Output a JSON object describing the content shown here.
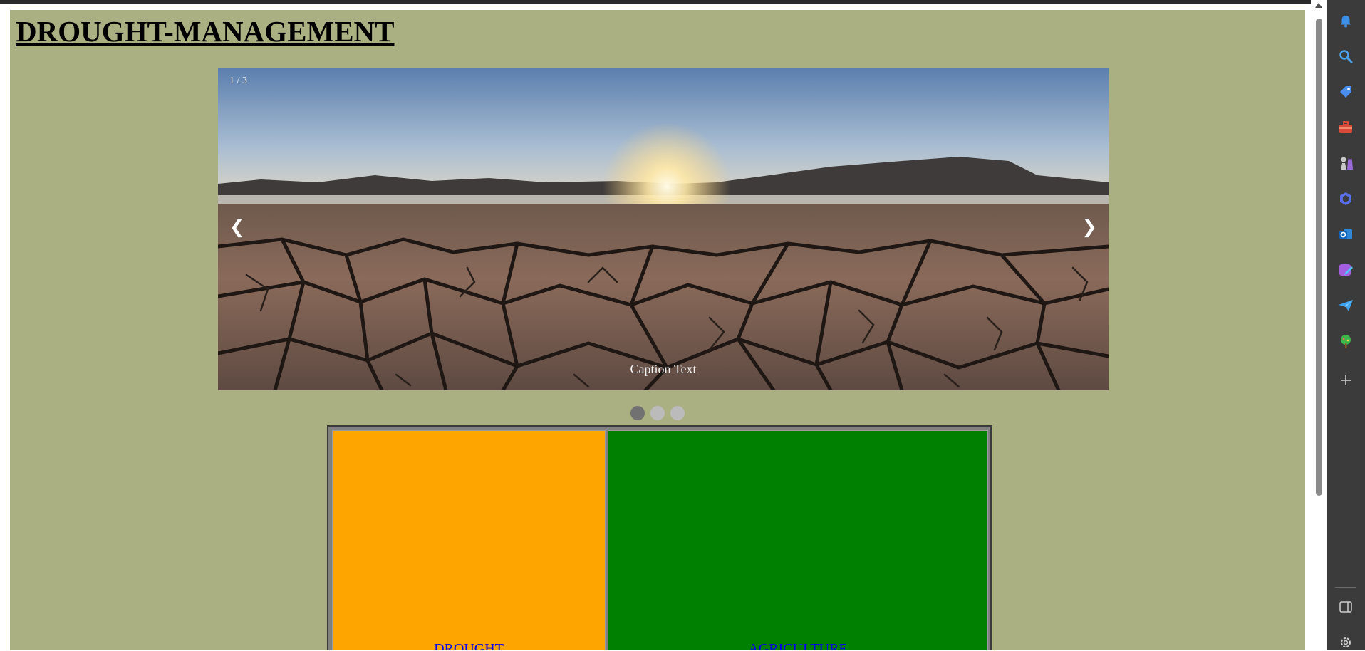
{
  "page": {
    "title": "DROUGHT-MANAGEMENT"
  },
  "slideshow": {
    "number_text": "1 / 3",
    "caption": "Caption Text",
    "prev_label": "❮",
    "next_label": "❯",
    "dots_count": 3,
    "active_dot": 1
  },
  "grid": {
    "cells": [
      {
        "label": "DROUGHT",
        "color": "#ffa500"
      },
      {
        "label": "AGRICULTURE",
        "color": "#008000"
      }
    ]
  },
  "colors": {
    "page_background": "#abb083",
    "sidebar_background": "#3b3b3b",
    "link": "#0000ee"
  },
  "sidebar": {
    "icons": [
      "bell-icon",
      "search-icon",
      "tag-icon",
      "toolbox-icon",
      "chess-icon",
      "copilot-icon",
      "outlook-icon",
      "designer-icon",
      "send-icon",
      "tree-icon",
      "add-icon",
      "split-screen-icon",
      "settings-icon"
    ]
  }
}
